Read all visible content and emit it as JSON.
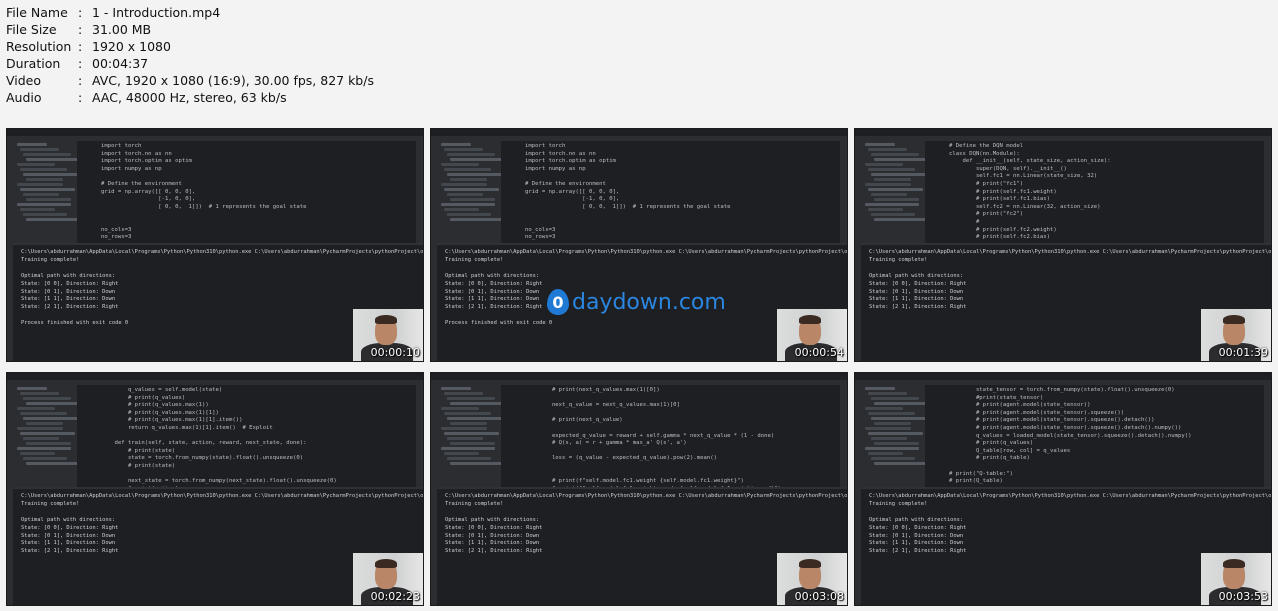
{
  "file_info": [
    {
      "label": "File Name",
      "sep": ":",
      "value": "1 - Introduction.mp4"
    },
    {
      "label": "File Size",
      "sep": ":",
      "value": "31.00 MB"
    },
    {
      "label": "Resolution",
      "sep": ":",
      "value": "1920 x 1080"
    },
    {
      "label": "Duration",
      "sep": ":",
      "value": "00:04:37"
    },
    {
      "label": "Video",
      "sep": ":",
      "value": "AVC, 1920 x 1080 (16:9), 30.00 fps, 827 kb/s"
    },
    {
      "label": "Audio",
      "sep": ":",
      "value": "AAC, 48000 Hz, stereo, 63 kb/s"
    }
  ],
  "watermark": {
    "icon_letter": "0",
    "text": "daydown.com"
  },
  "thumbnails": [
    {
      "timestamp": "00:00:10",
      "code": [
        "import torch",
        "import torch.nn as nn",
        "import torch.optim as optim",
        "import numpy as np",
        "",
        "# Define the environment",
        "grid = np.array([[ 0, 0, 0],",
        "                 [-1, 0, 0],",
        "                 [ 0, 0,  1]])  # 1 represents the goal state",
        "",
        "",
        "no_cols=3",
        "no_rows=3"
      ],
      "console": [
        "C:\\Users\\abdurrahman\\AppData\\Local\\Programs\\Python\\Python310\\python.exe C:\\Users\\abdurrahman\\PycharmProjects\\pythonProject\\openfoam\\ope",
        "Training complete!",
        "",
        "Optimal path with directions:",
        "State: [0 0], Direction: Right",
        "State: [0 1], Direction: Down",
        "State: [1 1], Direction: Down",
        "State: [2 1], Direction: Right",
        "",
        "Process finished with exit code 0"
      ]
    },
    {
      "timestamp": "00:00:54",
      "code": [
        "import torch",
        "import torch.nn as nn",
        "import torch.optim as optim",
        "import numpy as np",
        "",
        "# Define the environment",
        "grid = np.array([[ 0, 0, 0],",
        "                 [-1, 0, 0],",
        "                 [ 0, 0,  1]])  # 1 represents the goal state",
        "",
        "",
        "no_cols=3",
        "no_rows=3"
      ],
      "console": [
        "C:\\Users\\abdurrahman\\AppData\\Local\\Programs\\Python\\Python310\\python.exe C:\\Users\\abdurrahman\\PycharmProjects\\pythonProject\\openfoam\\ope",
        "Training complete!",
        "",
        "Optimal path with directions:",
        "State: [0 0], Direction: Right",
        "State: [0 1], Direction: Down",
        "State: [1 1], Direction: Down",
        "State: [2 1], Direction: Right",
        "",
        "Process finished with exit code 0"
      ]
    },
    {
      "timestamp": "00:01:39",
      "code": [
        "# Define the DQN model",
        "class DQN(nn.Module):",
        "    def __init__(self, state_size, action_size):",
        "        super(DQN, self).__init__()",
        "        self.fc1 = nn.Linear(state_size, 32)",
        "        # print(\"fc1\")",
        "        # print(self.fc1.weight)",
        "        # print(self.fc1.bias)",
        "        self.fc2 = nn.Linear(32, action_size)",
        "        # print(\"fc2\")",
        "        #",
        "        # print(self.fc2.weight)",
        "        # print(self.fc2.bias)",
        "",
        "    def forward(self, state):",
        "        # print(state)",
        "        # print(self.fc1(state))"
      ],
      "console": [
        "C:\\Users\\abdurrahman\\AppData\\Local\\Programs\\Python\\Python310\\python.exe C:\\Users\\abdurrahman\\PycharmProjects\\pythonProject\\openfoam\\ope",
        "Training complete!",
        "",
        "Optimal path with directions:",
        "State: [0 0], Direction: Right",
        "State: [0 1], Direction: Down",
        "State: [1 1], Direction: Down",
        "State: [2 1], Direction: Right"
      ]
    },
    {
      "timestamp": "00:02:23",
      "code": [
        "        q_values = self.model(state)",
        "        # print(q_values)",
        "        # print(q_values.max(1))",
        "        # print(q_values.max(1)[1])",
        "        # print(q_values.max(1)[1].item())",
        "        return q_values.max(1)[1].item()  # Exploit",
        "",
        "    def train(self, state, action, reward, next_state, done):",
        "        # print(state)",
        "        state = torch.from_numpy(state).float().unsqueeze(0)",
        "        # print(state)",
        "",
        "        next_state = torch.from_numpy(next_state).float().unsqueeze(0)",
        "        # print(action)",
        "        action = torch.tensor([action], dtype=torch.int64)",
        "        # print(action)",
        "        # print(reward)"
      ],
      "console": [
        "C:\\Users\\abdurrahman\\AppData\\Local\\Programs\\Python\\Python310\\python.exe C:\\Users\\abdurrahman\\PycharmProjects\\pythonProject\\openfoam\\ope",
        "Training complete!",
        "",
        "Optimal path with directions:",
        "State: [0 0], Direction: Right",
        "State: [0 1], Direction: Down",
        "State: [1 1], Direction: Down",
        "State: [2 1], Direction: Right"
      ]
    },
    {
      "timestamp": "00:03:08",
      "code": [
        "        # print(next_q_values.max(1)[0])",
        "",
        "        next_q_value = next_q_values.max(1)[0]",
        "",
        "        # print(next_q_value)",
        "",
        "        expected_q_value = reward + self.gamma * next_q_value * (1 - done)",
        "        # Q(s, a) = r + gamma * max_a' Q(s', a')",
        "",
        "        loss = (q_value - expected_q_value).pow(2).mean()",
        "",
        "",
        "        # print(f\"self.model.fc1.weight {self.model.fc1.weight}\")",
        "        # print(f\"self.model.fc1.weight.grad: {self.model.fc1.weight.grad}\")",
        "",
        "        loss.backward()"
      ],
      "console": [
        "C:\\Users\\abdurrahman\\AppData\\Local\\Programs\\Python\\Python310\\python.exe C:\\Users\\abdurrahman\\PycharmProjects\\pythonProject\\openfoam\\ope",
        "Training complete!",
        "",
        "Optimal path with directions:",
        "State: [0 0], Direction: Right",
        "State: [0 1], Direction: Down",
        "State: [1 1], Direction: Down",
        "State: [2 1], Direction: Right"
      ]
    },
    {
      "timestamp": "00:03:53",
      "code": [
        "        state_tensor = torch.from_numpy(state).float().unsqueeze(0)",
        "        #print(state_tensor)",
        "        # print(agent.model(state_tensor))",
        "        # print(agent.model(state_tensor).squeeze())",
        "        # print(agent.model(state_tensor).squeeze().detach())",
        "        # print(agent.model(state_tensor).squeeze().detach().numpy())",
        "        q_values = loaded_model(state_tensor).squeeze().detach().numpy()",
        "        # print(q_values)",
        "        Q_table[row, col] = q_values",
        "        # print(q_table)",
        "",
        "# print(\"Q-table:\")",
        "# print(Q_table)",
        "",
        "",
        "# Print the optimal path with directions",
        "start_state = np.array([0, 0])"
      ],
      "console": [
        "C:\\Users\\abdurrahman\\AppData\\Local\\Programs\\Python\\Python310\\python.exe C:\\Users\\abdurrahman\\PycharmProjects\\pythonProject\\openfoam\\ope",
        "Training complete!",
        "",
        "Optimal path with directions:",
        "State: [0 0], Direction: Right",
        "State: [0 1], Direction: Down",
        "State: [1 1], Direction: Down",
        "State: [2 1], Direction: Right"
      ]
    }
  ]
}
